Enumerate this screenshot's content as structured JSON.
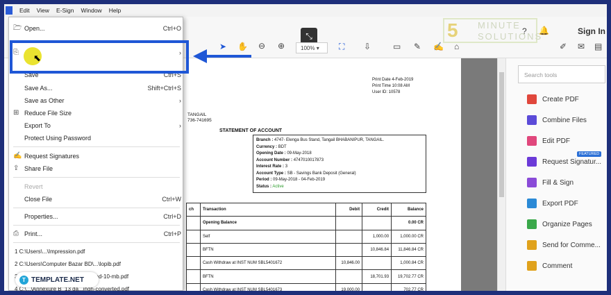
{
  "menubar": {
    "items": [
      "Edit",
      "View",
      "E-Sign",
      "Window",
      "Help"
    ]
  },
  "toolbar": {
    "zoom": "100%",
    "sign_in": "Sign In"
  },
  "watermark": {
    "brand_line1": "MINUTE",
    "brand_line2": "SOLUTIONS"
  },
  "file_menu": {
    "items": [
      {
        "label": "Open...",
        "shortcut": "Ctrl+O"
      },
      {
        "label": "",
        "shortcut": ""
      },
      {
        "label": "Save",
        "shortcut": "Ctrl+S"
      },
      {
        "label": "Save As...",
        "shortcut": "Shift+Ctrl+S"
      },
      {
        "label": "Save as Other",
        "shortcut": ""
      },
      {
        "label": "Reduce File Size",
        "shortcut": ""
      },
      {
        "label": "Export To",
        "shortcut": ""
      },
      {
        "label": "Protect Using Password",
        "shortcut": ""
      },
      {
        "label": "Request Signatures",
        "shortcut": ""
      },
      {
        "label": "Share File",
        "shortcut": ""
      },
      {
        "label": "Revert",
        "shortcut": ""
      },
      {
        "label": "Close File",
        "shortcut": "Ctrl+W"
      },
      {
        "label": "Properties...",
        "shortcut": "Ctrl+D"
      },
      {
        "label": "Print...",
        "shortcut": "Ctrl+P"
      }
    ],
    "recent": [
      "1 C:\\Users\\...\\Impression.pdf",
      "2 C:\\Users\\Computer Bazar BD\\...\\lopib.pdf",
      "3 C:\\Users\\...\\sample-pdf-download-10-mb.pdf",
      "4 C:\\...\\Annexure B_13 da...ingh-converted.pdf"
    ]
  },
  "document": {
    "print_date": "Print Date 4-Feb-2019",
    "print_time": "Print Time 10:08 AM",
    "user_id": "User ID: 10578",
    "addr1": "TANGAIL",
    "addr2": "736-741695",
    "title": "STATEMENT OF ACCOUNT",
    "account": {
      "branch_label": "Branch :",
      "branch": "4747- Elenga Bus Stand, Tangail BHABANIPUR, TANGAIL.",
      "currency_label": "Currency :",
      "currency": "BDT",
      "opening_label": "Opening Date :",
      "opening": "09-May-2018",
      "number_label": "Account Number :",
      "number": "4747010017873",
      "rate_label": "Interest Rate :",
      "rate": "3",
      "type_label": "Account Type :",
      "type": "SB - Savings Bank Deposit (General)",
      "period_label": "Period :",
      "period": "09-May-2018 - 04-Feb-2019",
      "status_label": "Status :",
      "status": "Active"
    },
    "table": {
      "headers": [
        "ch",
        "Transaction",
        "Debit",
        "Credit",
        "Balance"
      ],
      "rows": [
        [
          "",
          "Opening Balance",
          "",
          "",
          "0.00 CR"
        ],
        [
          "",
          "Self",
          "",
          "1,000.00",
          "1,000.00 CR"
        ],
        [
          "",
          "BFTN",
          "",
          "10,846.84",
          "11,846.84 CR"
        ],
        [
          "",
          "Cash Withdraw at INST NUM SBL5401672",
          "10,846.00",
          "",
          "1,000.84 CR"
        ],
        [
          "",
          "BFTN",
          "",
          "18,701.93",
          "19,702.77 CR"
        ],
        [
          "",
          "Cash Withdraw at INST NUM SBL5401673",
          "19,000.00",
          "",
          "702.77 CR"
        ]
      ]
    }
  },
  "tools_panel": {
    "search_placeholder": "Search tools",
    "featured_badge": "FEATURED",
    "tools": [
      {
        "label": "Create PDF",
        "color": "#e0473c"
      },
      {
        "label": "Combine Files",
        "color": "#5b4bd8"
      },
      {
        "label": "Edit PDF",
        "color": "#e0477c"
      },
      {
        "label": "Request Signatur...",
        "color": "#6b3ad8"
      },
      {
        "label": "Fill & Sign",
        "color": "#8a4bd8"
      },
      {
        "label": "Export PDF",
        "color": "#2b8ad6"
      },
      {
        "label": "Organize Pages",
        "color": "#3aa84a"
      },
      {
        "label": "Send for Comme...",
        "color": "#e0a21c"
      },
      {
        "label": "Comment",
        "color": "#e0a21c"
      }
    ]
  },
  "brand": {
    "name": "TEMPLATE.NET",
    "logo_letter": "T"
  }
}
